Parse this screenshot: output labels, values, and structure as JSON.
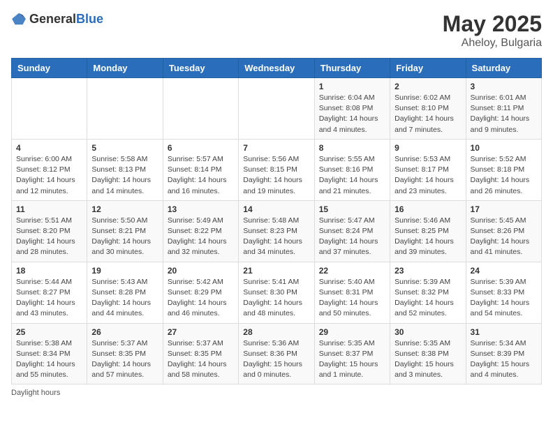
{
  "header": {
    "logo_general": "General",
    "logo_blue": "Blue",
    "month": "May 2025",
    "location": "Aheloy, Bulgaria"
  },
  "days_of_week": [
    "Sunday",
    "Monday",
    "Tuesday",
    "Wednesday",
    "Thursday",
    "Friday",
    "Saturday"
  ],
  "footer": {
    "note": "Daylight hours"
  },
  "weeks": [
    [
      {
        "day": "",
        "info": ""
      },
      {
        "day": "",
        "info": ""
      },
      {
        "day": "",
        "info": ""
      },
      {
        "day": "",
        "info": ""
      },
      {
        "day": "1",
        "info": "Sunrise: 6:04 AM\nSunset: 8:08 PM\nDaylight: 14 hours\nand 4 minutes."
      },
      {
        "day": "2",
        "info": "Sunrise: 6:02 AM\nSunset: 8:10 PM\nDaylight: 14 hours\nand 7 minutes."
      },
      {
        "day": "3",
        "info": "Sunrise: 6:01 AM\nSunset: 8:11 PM\nDaylight: 14 hours\nand 9 minutes."
      }
    ],
    [
      {
        "day": "4",
        "info": "Sunrise: 6:00 AM\nSunset: 8:12 PM\nDaylight: 14 hours\nand 12 minutes."
      },
      {
        "day": "5",
        "info": "Sunrise: 5:58 AM\nSunset: 8:13 PM\nDaylight: 14 hours\nand 14 minutes."
      },
      {
        "day": "6",
        "info": "Sunrise: 5:57 AM\nSunset: 8:14 PM\nDaylight: 14 hours\nand 16 minutes."
      },
      {
        "day": "7",
        "info": "Sunrise: 5:56 AM\nSunset: 8:15 PM\nDaylight: 14 hours\nand 19 minutes."
      },
      {
        "day": "8",
        "info": "Sunrise: 5:55 AM\nSunset: 8:16 PM\nDaylight: 14 hours\nand 21 minutes."
      },
      {
        "day": "9",
        "info": "Sunrise: 5:53 AM\nSunset: 8:17 PM\nDaylight: 14 hours\nand 23 minutes."
      },
      {
        "day": "10",
        "info": "Sunrise: 5:52 AM\nSunset: 8:18 PM\nDaylight: 14 hours\nand 26 minutes."
      }
    ],
    [
      {
        "day": "11",
        "info": "Sunrise: 5:51 AM\nSunset: 8:20 PM\nDaylight: 14 hours\nand 28 minutes."
      },
      {
        "day": "12",
        "info": "Sunrise: 5:50 AM\nSunset: 8:21 PM\nDaylight: 14 hours\nand 30 minutes."
      },
      {
        "day": "13",
        "info": "Sunrise: 5:49 AM\nSunset: 8:22 PM\nDaylight: 14 hours\nand 32 minutes."
      },
      {
        "day": "14",
        "info": "Sunrise: 5:48 AM\nSunset: 8:23 PM\nDaylight: 14 hours\nand 34 minutes."
      },
      {
        "day": "15",
        "info": "Sunrise: 5:47 AM\nSunset: 8:24 PM\nDaylight: 14 hours\nand 37 minutes."
      },
      {
        "day": "16",
        "info": "Sunrise: 5:46 AM\nSunset: 8:25 PM\nDaylight: 14 hours\nand 39 minutes."
      },
      {
        "day": "17",
        "info": "Sunrise: 5:45 AM\nSunset: 8:26 PM\nDaylight: 14 hours\nand 41 minutes."
      }
    ],
    [
      {
        "day": "18",
        "info": "Sunrise: 5:44 AM\nSunset: 8:27 PM\nDaylight: 14 hours\nand 43 minutes."
      },
      {
        "day": "19",
        "info": "Sunrise: 5:43 AM\nSunset: 8:28 PM\nDaylight: 14 hours\nand 44 minutes."
      },
      {
        "day": "20",
        "info": "Sunrise: 5:42 AM\nSunset: 8:29 PM\nDaylight: 14 hours\nand 46 minutes."
      },
      {
        "day": "21",
        "info": "Sunrise: 5:41 AM\nSunset: 8:30 PM\nDaylight: 14 hours\nand 48 minutes."
      },
      {
        "day": "22",
        "info": "Sunrise: 5:40 AM\nSunset: 8:31 PM\nDaylight: 14 hours\nand 50 minutes."
      },
      {
        "day": "23",
        "info": "Sunrise: 5:39 AM\nSunset: 8:32 PM\nDaylight: 14 hours\nand 52 minutes."
      },
      {
        "day": "24",
        "info": "Sunrise: 5:39 AM\nSunset: 8:33 PM\nDaylight: 14 hours\nand 54 minutes."
      }
    ],
    [
      {
        "day": "25",
        "info": "Sunrise: 5:38 AM\nSunset: 8:34 PM\nDaylight: 14 hours\nand 55 minutes."
      },
      {
        "day": "26",
        "info": "Sunrise: 5:37 AM\nSunset: 8:35 PM\nDaylight: 14 hours\nand 57 minutes."
      },
      {
        "day": "27",
        "info": "Sunrise: 5:37 AM\nSunset: 8:35 PM\nDaylight: 14 hours\nand 58 minutes."
      },
      {
        "day": "28",
        "info": "Sunrise: 5:36 AM\nSunset: 8:36 PM\nDaylight: 15 hours\nand 0 minutes."
      },
      {
        "day": "29",
        "info": "Sunrise: 5:35 AM\nSunset: 8:37 PM\nDaylight: 15 hours\nand 1 minute."
      },
      {
        "day": "30",
        "info": "Sunrise: 5:35 AM\nSunset: 8:38 PM\nDaylight: 15 hours\nand 3 minutes."
      },
      {
        "day": "31",
        "info": "Sunrise: 5:34 AM\nSunset: 8:39 PM\nDaylight: 15 hours\nand 4 minutes."
      }
    ]
  ]
}
